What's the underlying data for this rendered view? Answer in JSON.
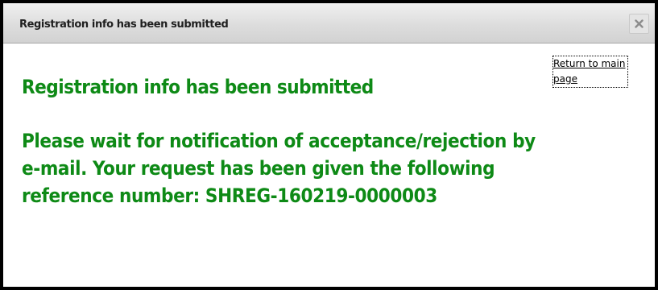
{
  "dialog": {
    "title": "Registration info has been submitted",
    "close_icon": "close-x-icon"
  },
  "content": {
    "return_link": "Return to main page",
    "heading": "Registration info has been submitted",
    "message": "Please wait for notification of acceptance/rejection by e-mail. Your request has been given the following reference number: SHREG-160219-0000003"
  },
  "colors": {
    "message_text": "#0e8a16",
    "titlebar_background": "#dddddd",
    "dialog_border": "#000000"
  }
}
